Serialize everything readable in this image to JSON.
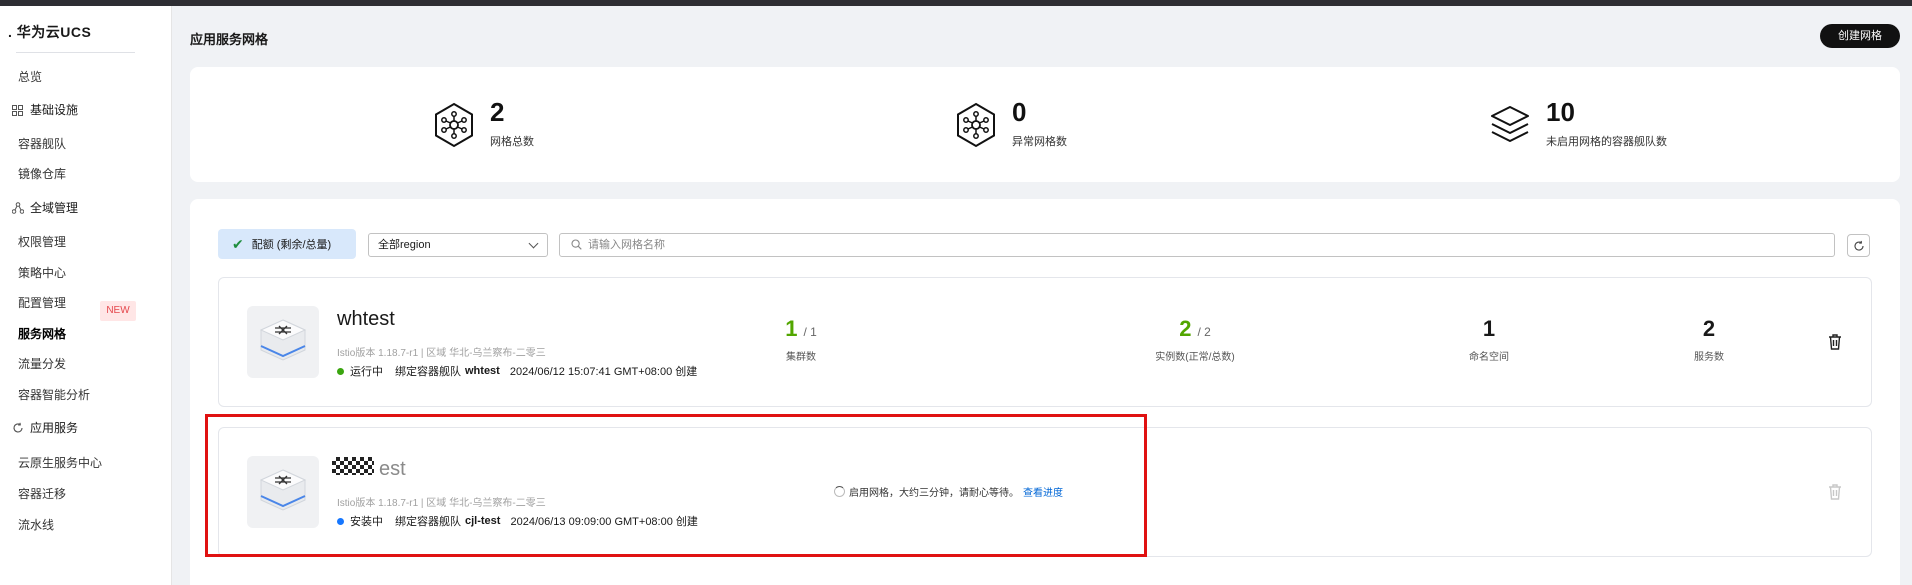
{
  "app": {
    "brand": "华为云UCS",
    "page_title": "应用服务网格",
    "create_button": "创建网格"
  },
  "sidebar": {
    "items": [
      {
        "type": "item",
        "label": "总览"
      },
      {
        "type": "group",
        "label": "基础设施",
        "icon": "grid-icon"
      },
      {
        "type": "item",
        "label": "容器舰队"
      },
      {
        "type": "item",
        "label": "镜像仓库"
      },
      {
        "type": "group",
        "label": "全域管理",
        "icon": "network-icon"
      },
      {
        "type": "item",
        "label": "权限管理"
      },
      {
        "type": "item",
        "label": "策略中心"
      },
      {
        "type": "item",
        "label": "配置管理",
        "badge": "NEW"
      },
      {
        "type": "item",
        "label": "服务网格",
        "active": true
      },
      {
        "type": "item",
        "label": "流量分发"
      },
      {
        "type": "item",
        "label": "容器智能分析"
      },
      {
        "type": "group",
        "label": "应用服务",
        "icon": "cycle-icon"
      },
      {
        "type": "item",
        "label": "云原生服务中心"
      },
      {
        "type": "item",
        "label": "容器迁移"
      },
      {
        "type": "item",
        "label": "流水线"
      }
    ]
  },
  "stats": [
    {
      "value": "2",
      "label": "网格总数",
      "icon": "mesh-icon"
    },
    {
      "value": "0",
      "label": "异常网格数",
      "icon": "mesh-icon"
    },
    {
      "value": "10",
      "label": "未启用网格的容器舰队数",
      "icon": "layers-icon"
    }
  ],
  "filters": {
    "quota_label": "配额 (剩余/总量)",
    "region_value": "全部region",
    "search_placeholder": "请输入网格名称"
  },
  "meshes": [
    {
      "name": "whtest",
      "meta": "Istio版本 1.18.7-r1 | 区域 华北-乌兰察布-二零三",
      "status": "运行中",
      "status_color": "#3aa50f",
      "bind_label": "绑定容器舰队",
      "fleet": "whtest",
      "created": "2024/06/12 15:07:41 GMT+08:00 创建",
      "metrics": [
        {
          "value": "1",
          "total": "/ 1",
          "label": "集群数"
        },
        {
          "value": "2",
          "total": "/ 2",
          "label": "实例数(正常/总数)"
        },
        {
          "value": "1",
          "total": "",
          "label": "命名空间"
        },
        {
          "value": "2",
          "total": "",
          "label": "服务数"
        }
      ]
    },
    {
      "name": "est",
      "meta": "Istio版本 1.18.7-r1 | 区域 华北-乌兰察布-二零三",
      "status": "安装中",
      "status_color": "#1677ff",
      "bind_label": "绑定容器舰队",
      "fleet": "cjl-test",
      "created": "2024/06/13 09:09:00 GMT+08:00 创建",
      "progress_text": "启用网格，大约三分钟，请耐心等待。",
      "progress_link": "查看进度"
    }
  ]
}
